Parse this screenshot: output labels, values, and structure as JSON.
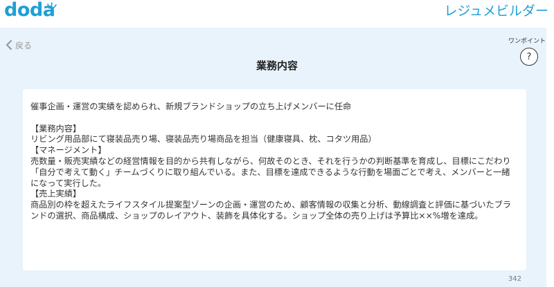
{
  "header": {
    "logo_text": "doda",
    "app_title": "レジュメビルダー",
    "brand_color": "#1f9fd6"
  },
  "nav": {
    "back_label": "戻る",
    "back_icon": "chevron-left-icon"
  },
  "page": {
    "title": "業務内容"
  },
  "help": {
    "label": "ワンポイント",
    "button_glyph": "?",
    "icon": "question-icon"
  },
  "editor": {
    "value": "催事企画・運営の実績を認められ、新規ブランドショップの立ち上げメンバーに任命\n\n【業務内容】\nリビング用品部にて寝装品売り場、寝装品売り場商品を担当（健康寝具、枕、コタツ用品）\n【マネージメント】\n売数量・販売実績などの経営情報を目的から共有しながら、何故そのとき、それを行うかの判断基準を育成し、目標にこだわり「自分で考えて動く」チームづくりに取り組んでいる。また、目標を達成できるような行動を場面ごとで考え、メンバーと一緒になって実行した。\n【売上実績】\n商品別の枠を超えたライフスタイル提案型ゾーンの企画・運営のため、顧客情報の収集と分析、動線調査と評価に基づいたブランドの選択、商品構成、ショップのレイアウト、装飾を具体化する。ショップ全体の売り上げは予算比××%増を達成。",
    "char_count": "342"
  }
}
